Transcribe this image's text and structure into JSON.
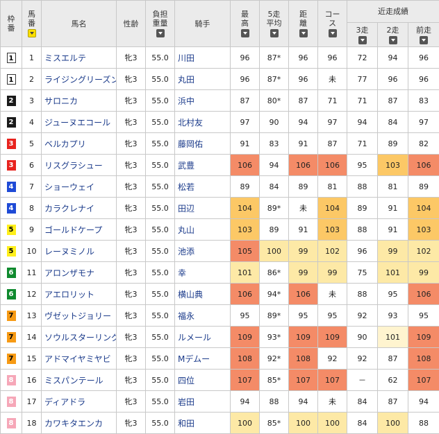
{
  "colors": {
    "high": "#f48b67",
    "mid": "#fcc866",
    "low": "#fde9a6",
    "faint": "#fff4cf",
    "header": "#ebebeb",
    "link": "#1a3a8a"
  },
  "header": {
    "waku": [
      "枠",
      "番"
    ],
    "umaban": [
      "馬",
      "番"
    ],
    "name": "馬名",
    "sexage": "性齢",
    "weight": [
      "負担",
      "重量"
    ],
    "jockey": "騎手",
    "best": [
      "最",
      "高"
    ],
    "avg5": [
      "5走",
      "平均"
    ],
    "distance": [
      "距",
      "離"
    ],
    "course": [
      "コー",
      "ス"
    ],
    "recent_group": "近走成績",
    "recent3": "3走",
    "recent2": "2走",
    "recent1": "前走"
  },
  "rows": [
    {
      "waku": "1",
      "umaban": "1",
      "name": "ミスエルテ",
      "sexage": "牝3",
      "weight": "55.0",
      "jockey": "川田",
      "best": "96",
      "avg5": "87*",
      "dist": "96",
      "course": "96",
      "r3": "72",
      "r2": "94",
      "r1": "96",
      "hl": [
        "",
        "",
        "",
        "",
        "",
        "",
        ""
      ]
    },
    {
      "waku": "1",
      "umaban": "2",
      "name": "ライジングリーズン",
      "sexage": "牝3",
      "weight": "55.0",
      "jockey": "丸田",
      "best": "96",
      "avg5": "87*",
      "dist": "96",
      "course": "未",
      "r3": "77",
      "r2": "96",
      "r1": "96",
      "hl": [
        "",
        "",
        "",
        "",
        "",
        "",
        ""
      ]
    },
    {
      "waku": "2",
      "umaban": "3",
      "name": "サロニカ",
      "sexage": "牝3",
      "weight": "55.0",
      "jockey": "浜中",
      "best": "87",
      "avg5": "80*",
      "dist": "87",
      "course": "71",
      "r3": "71",
      "r2": "87",
      "r1": "83",
      "hl": [
        "",
        "",
        "",
        "",
        "",
        "",
        ""
      ]
    },
    {
      "waku": "2",
      "umaban": "4",
      "name": "ジューヌエコール",
      "sexage": "牝3",
      "weight": "55.0",
      "jockey": "北村友",
      "best": "97",
      "avg5": "90",
      "dist": "94",
      "course": "97",
      "r3": "94",
      "r2": "84",
      "r1": "97",
      "hl": [
        "",
        "",
        "",
        "",
        "",
        "",
        ""
      ]
    },
    {
      "waku": "3",
      "umaban": "5",
      "name": "ベルカプリ",
      "sexage": "牝3",
      "weight": "55.0",
      "jockey": "藤岡佑",
      "best": "91",
      "avg5": "83",
      "dist": "91",
      "course": "87",
      "r3": "71",
      "r2": "89",
      "r1": "82",
      "hl": [
        "",
        "",
        "",
        "",
        "",
        "",
        ""
      ]
    },
    {
      "waku": "3",
      "umaban": "6",
      "name": "リスグラシュー",
      "sexage": "牝3",
      "weight": "55.0",
      "jockey": "武豊",
      "best": "106",
      "avg5": "94",
      "dist": "106",
      "course": "106",
      "r3": "95",
      "r2": "103",
      "r1": "106",
      "hl": [
        "r",
        "",
        "r",
        "r",
        "",
        "o",
        "r"
      ]
    },
    {
      "waku": "4",
      "umaban": "7",
      "name": "ショーウェイ",
      "sexage": "牝3",
      "weight": "55.0",
      "jockey": "松若",
      "best": "89",
      "avg5": "84",
      "dist": "89",
      "course": "81",
      "r3": "88",
      "r2": "81",
      "r1": "89",
      "hl": [
        "",
        "",
        "",
        "",
        "",
        "",
        ""
      ]
    },
    {
      "waku": "4",
      "umaban": "8",
      "name": "カラクレナイ",
      "sexage": "牝3",
      "weight": "55.0",
      "jockey": "田辺",
      "best": "104",
      "avg5": "89*",
      "dist": "未",
      "course": "104",
      "r3": "89",
      "r2": "91",
      "r1": "104",
      "hl": [
        "o",
        "",
        "",
        "o",
        "",
        "",
        "o"
      ]
    },
    {
      "waku": "5",
      "umaban": "9",
      "name": "ゴールドケープ",
      "sexage": "牝3",
      "weight": "55.0",
      "jockey": "丸山",
      "best": "103",
      "avg5": "89",
      "dist": "91",
      "course": "103",
      "r3": "88",
      "r2": "91",
      "r1": "103",
      "hl": [
        "o",
        "",
        "",
        "o",
        "",
        "",
        "o"
      ]
    },
    {
      "waku": "5",
      "umaban": "10",
      "name": "レーヌミノル",
      "sexage": "牝3",
      "weight": "55.0",
      "jockey": "池添",
      "best": "105",
      "avg5": "100",
      "dist": "99",
      "course": "102",
      "r3": "96",
      "r2": "99",
      "r1": "102",
      "hl": [
        "r",
        "y",
        "y",
        "y",
        "",
        "y",
        "y"
      ]
    },
    {
      "waku": "6",
      "umaban": "11",
      "name": "アロンザモナ",
      "sexage": "牝3",
      "weight": "55.0",
      "jockey": "幸",
      "best": "101",
      "avg5": "86*",
      "dist": "99",
      "course": "99",
      "r3": "75",
      "r2": "101",
      "r1": "99",
      "hl": [
        "y",
        "",
        "y",
        "y",
        "",
        "y",
        "y"
      ]
    },
    {
      "waku": "6",
      "umaban": "12",
      "name": "アエロリット",
      "sexage": "牝3",
      "weight": "55.0",
      "jockey": "横山典",
      "best": "106",
      "avg5": "94*",
      "dist": "106",
      "course": "未",
      "r3": "88",
      "r2": "95",
      "r1": "106",
      "hl": [
        "r",
        "",
        "r",
        "",
        "",
        "",
        "r"
      ]
    },
    {
      "waku": "7",
      "umaban": "13",
      "name": "ヴゼットジョリー",
      "sexage": "牝3",
      "weight": "55.0",
      "jockey": "福永",
      "best": "95",
      "avg5": "89*",
      "dist": "95",
      "course": "95",
      "r3": "92",
      "r2": "93",
      "r1": "95",
      "hl": [
        "",
        "",
        "",
        "",
        "",
        "",
        ""
      ]
    },
    {
      "waku": "7",
      "umaban": "14",
      "name": "ソウルスターリング",
      "sexage": "牝3",
      "weight": "55.0",
      "jockey": "ルメール",
      "best": "109",
      "avg5": "93*",
      "dist": "109",
      "course": "109",
      "r3": "90",
      "r2": "101",
      "r1": "109",
      "hl": [
        "r",
        "",
        "r",
        "r",
        "",
        "p",
        "r"
      ]
    },
    {
      "waku": "7",
      "umaban": "15",
      "name": "アドマイヤミヤビ",
      "sexage": "牝3",
      "weight": "55.0",
      "jockey": "Mデムー",
      "best": "108",
      "avg5": "92*",
      "dist": "108",
      "course": "92",
      "r3": "92",
      "r2": "87",
      "r1": "108",
      "hl": [
        "r",
        "",
        "r",
        "",
        "",
        "",
        "r"
      ]
    },
    {
      "waku": "8",
      "umaban": "16",
      "name": "ミスパンテール",
      "sexage": "牝3",
      "weight": "55.0",
      "jockey": "四位",
      "best": "107",
      "avg5": "85*",
      "dist": "107",
      "course": "107",
      "r3": "－",
      "r2": "62",
      "r1": "107",
      "hl": [
        "r",
        "",
        "r",
        "r",
        "",
        "",
        "r"
      ]
    },
    {
      "waku": "8",
      "umaban": "17",
      "name": "ディアドラ",
      "sexage": "牝3",
      "weight": "55.0",
      "jockey": "岩田",
      "best": "94",
      "avg5": "88",
      "dist": "94",
      "course": "未",
      "r3": "84",
      "r2": "87",
      "r1": "94",
      "hl": [
        "",
        "",
        "",
        "",
        "",
        "",
        ""
      ]
    },
    {
      "waku": "8",
      "umaban": "18",
      "name": "カワキタエンカ",
      "sexage": "牝3",
      "weight": "55.0",
      "jockey": "和田",
      "best": "100",
      "avg5": "85*",
      "dist": "100",
      "course": "100",
      "r3": "84",
      "r2": "100",
      "r1": "88",
      "hl": [
        "y",
        "",
        "y",
        "y",
        "",
        "y",
        ""
      ]
    }
  ]
}
